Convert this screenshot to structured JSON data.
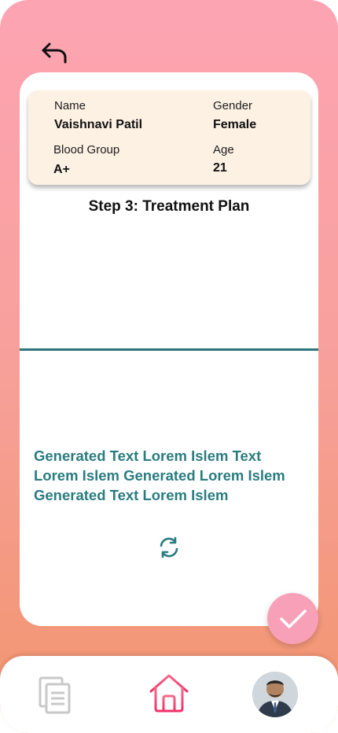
{
  "patient": {
    "name_label": "Name",
    "name_value": "Vaishnavi Patil",
    "gender_label": "Gender",
    "gender_value": "Female",
    "blood_group_label": "Blood Group",
    "blood_group_value": "A+",
    "age_label": "Age",
    "age_value": "21"
  },
  "step_title": "Step 3: Treatment Plan",
  "generated_text": "Generated Text Lorem Islem Text Lorem Islem Generated Lorem Islem Generated Text Lorem Islem",
  "icons": {
    "back": "back-arrow-icon",
    "refresh": "refresh-icon",
    "confirm": "checkmark-icon",
    "documents": "documents-icon",
    "home": "home-icon",
    "profile": "avatar"
  },
  "colors": {
    "gradient_top": "#fda4b3",
    "gradient_bottom": "#f2956e",
    "patient_card_bg": "#fdf1e4",
    "accent_teal": "#2a7c80",
    "check_button": "#f7a0b8",
    "home_active": "#f0306a",
    "nav_inactive": "#c8c8c8"
  }
}
